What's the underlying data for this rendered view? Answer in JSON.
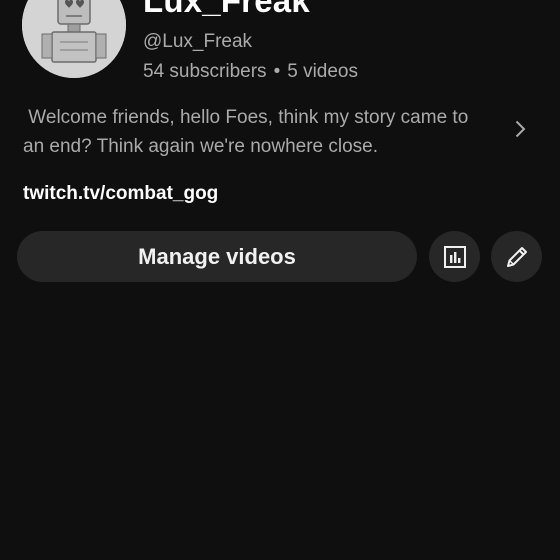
{
  "channel": {
    "name": "Lux_Freak",
    "handle": "@Lux_Freak",
    "subscribers": "54 subscribers",
    "separator": "•",
    "videos": "5 videos",
    "description": " Welcome friends, hello Foes, think my story came to an end? Think again we're nowhere close.",
    "link": "twitch.tv/combat_gog"
  },
  "actions": {
    "manage_videos_label": "Manage videos",
    "analytics_icon": "bar-chart-icon",
    "edit_icon": "pencil-icon",
    "more_icon": "chevron-right-icon"
  },
  "colors": {
    "background": "#0f0f0f",
    "button_bg": "#272727",
    "primary_text": "#ffffff",
    "secondary_text": "#aaaaaa"
  }
}
